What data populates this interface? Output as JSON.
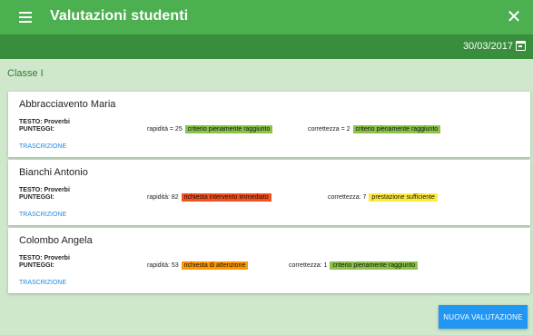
{
  "app": {
    "title": "Valutazioni studenti"
  },
  "header": {
    "date": "30/03/2017"
  },
  "section": {
    "title": "Classe I"
  },
  "students": [
    {
      "name": "Abbracciavento Maria",
      "test": "TESTO: Proverbi",
      "scores_label": "PUNTEGGI:",
      "speed": "rapidità = 25",
      "speed_badge": "criterio pienamente raggiunto",
      "speed_color": "#8bc34a",
      "accuracy": "correttezza = 2",
      "accuracy_badge": "criterio pienamente raggiunto",
      "accuracy_color": "#8bc34a",
      "link": "TRASCRIZIONE"
    },
    {
      "name": "Bianchi Antonio",
      "test": "TESTO: Proverbi",
      "scores_label": "PUNTEGGI:",
      "speed": "rapidità: 82",
      "speed_badge": "richiesta intervento immediato",
      "speed_color": "#f4511e",
      "accuracy": "correttezza: 7",
      "accuracy_badge": "prestazione sufficiente",
      "accuracy_color": "#ffeb3b",
      "link": "TRASCRIZIONE"
    },
    {
      "name": "Colombo Angela",
      "test": "TESTO: Proverbi",
      "scores_label": "PUNTEGGI:",
      "speed": "rapidità: 53",
      "speed_badge": "richiesta di attenzione",
      "speed_color": "#ff9800",
      "accuracy": "correttezza: 1",
      "accuracy_badge": "criterio pienamente raggiunto",
      "accuracy_color": "#8bc34a",
      "link": "TRASCRIZIONE"
    }
  ],
  "actions": {
    "new_evaluation": "NUOVA VALUTAZIONE"
  },
  "icons": {
    "menu": "menu-icon",
    "close": "close-icon",
    "calendar": "calendar-icon"
  },
  "colors": {
    "primary": "#4caf50",
    "primary_dark": "#388e3c",
    "background": "#cfe8cc",
    "accent": "#2196f3"
  }
}
